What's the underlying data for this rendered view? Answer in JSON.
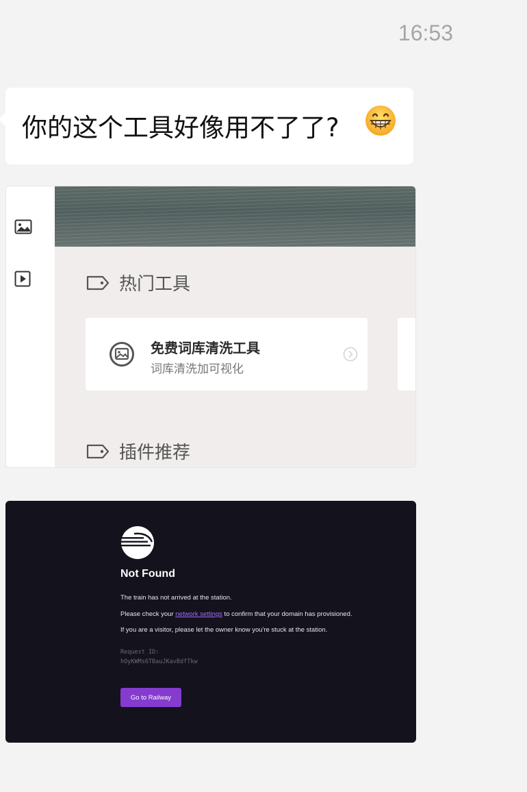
{
  "chat": {
    "timestamp": "16:53",
    "message": "你的这个工具好像用不了了?",
    "emoji": "grinning-face-icon"
  },
  "screenshot_tools": {
    "sidebar_icons": [
      "image-icon",
      "play-icon"
    ],
    "hot_section_title": "热门工具",
    "tool_card": {
      "title": "免费词库清洗工具",
      "subtitle": "词库清洗加可视化"
    },
    "plugin_section_title": "插件推荐",
    "colors": {
      "background": "#f1eded",
      "card": "#ffffff"
    }
  },
  "screenshot_error": {
    "title": "Not Found",
    "line1": "The train has not arrived at the station.",
    "line2_prefix": "Please check your ",
    "line2_link": "network settings",
    "line2_suffix": " to confirm that your domain has provisioned.",
    "line3": "If you are a visitor, please let the owner know you're stuck at the station.",
    "request_id_label": "Request ID:",
    "request_id": "hOyKWMs6TBauJKavBdfTkw",
    "button_label": "Go to Railway",
    "colors": {
      "background": "#13121d",
      "link": "#a46cff",
      "button": "#853bce"
    }
  }
}
